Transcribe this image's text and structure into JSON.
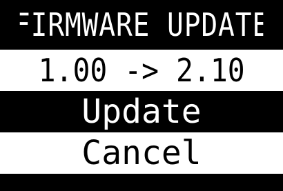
{
  "screen": {
    "title": "FIRMWARE UPDATE",
    "version_change": "1.00 -> 2.10",
    "menu": {
      "update_label": "Update",
      "cancel_label": "Cancel",
      "selected": "Update"
    }
  },
  "colors": {
    "background": "#000000",
    "foreground": "#ffffff",
    "highlight_background": "#ffffff",
    "highlight_text": "#000000"
  }
}
